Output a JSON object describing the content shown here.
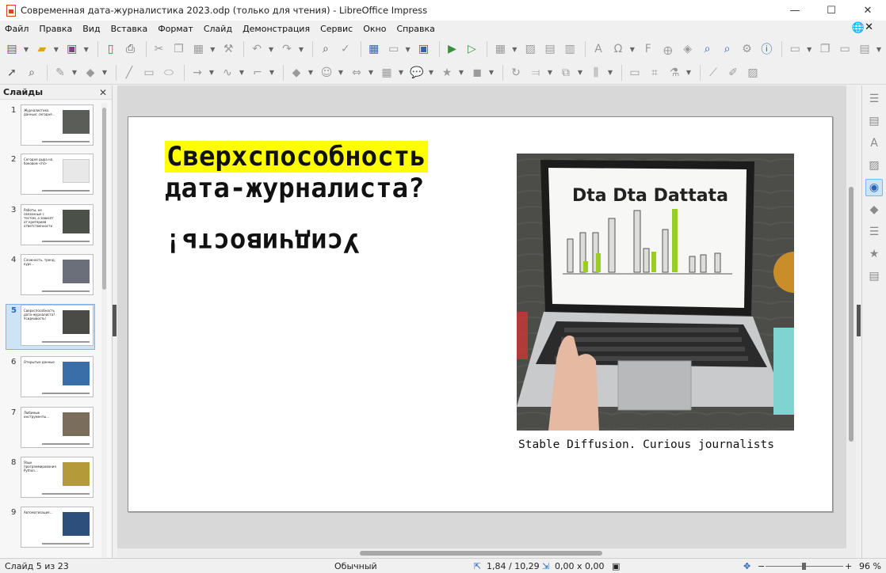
{
  "window": {
    "title": "Современная дата-журналистика 2023.odp (только для чтения) - LibreOffice Impress",
    "minimize": "—",
    "maximize": "☐",
    "close": "✕"
  },
  "menu": [
    "Файл",
    "Правка",
    "Вид",
    "Вставка",
    "Формат",
    "Слайд",
    "Демонстрация",
    "Сервис",
    "Окно",
    "Справка"
  ],
  "slides_panel": {
    "title": "Слайды",
    "close": "✕",
    "thumbnails": [
      {
        "num": "1",
        "text": "Журналистика данных: сегодня…",
        "selected": false
      },
      {
        "num": "2",
        "text": "Сегодня дыра на боковом <hl>",
        "selected": false
      },
      {
        "num": "3",
        "text": "Работы, не связанные с тестом, а зависят от критериев ответственности",
        "selected": false
      },
      {
        "num": "4",
        "text": "Сложность, тренд, курс…",
        "selected": false
      },
      {
        "num": "5",
        "text": "Сверхспособность дата-журналиста? Усидчивость!",
        "selected": true
      },
      {
        "num": "6",
        "text": "Открытые данные",
        "selected": false
      },
      {
        "num": "7",
        "text": "Любимые инструменты…",
        "selected": false
      },
      {
        "num": "8",
        "text": "Язык программирования Python…",
        "selected": false
      },
      {
        "num": "9",
        "text": "Автоматизация…",
        "selected": false
      }
    ]
  },
  "slide": {
    "heading_line1": "Сверхспособность",
    "heading_line2": "дата-журналиста?",
    "flipped_text": "Усидчивость!",
    "photo_screen_title": "Dta Dta Dattata",
    "caption": "Stable Diffusion. Curious journalists"
  },
  "status": {
    "slide_of": "Слайд 5 из 23",
    "layout": "Обычный",
    "position": "1,84 / 10,29",
    "size": "0,00 x 0,00",
    "zoom": "96 %",
    "zoom_minus": "−",
    "zoom_plus": "+"
  },
  "colors": {
    "highlight": "#ffff00",
    "accent": "#2a66b8",
    "selection": "#cde4f7"
  }
}
